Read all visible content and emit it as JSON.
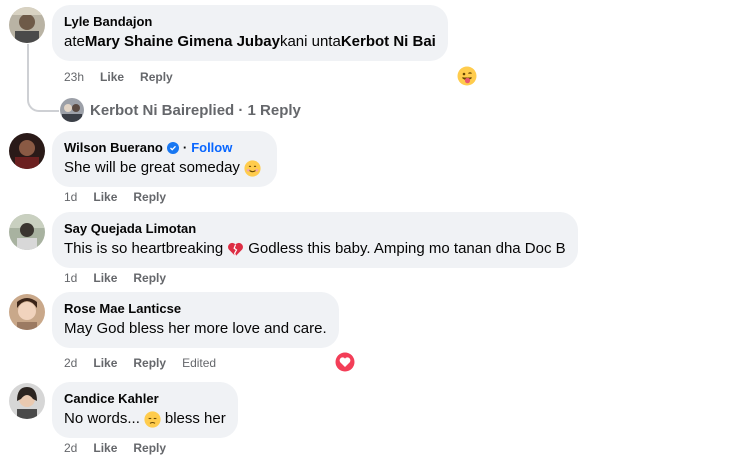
{
  "comments": [
    {
      "author": "Lyle Bandajon",
      "text_parts": [
        "ate ",
        "Mary Shaine Gimena Jubay",
        " kani unta ",
        "Kerbot Ni Bai"
      ],
      "time": "23h",
      "like_label": "Like",
      "reply_label": "Reply",
      "reaction": "tongue-wink-emoji",
      "replies": {
        "replier": "Kerbot Ni Bai",
        "text": " replied · 1 Reply"
      }
    },
    {
      "author": "Wilson Buerano",
      "verified": true,
      "follow_label": "Follow",
      "text": "She will be great someday",
      "inline_emoji": "smile-emoji",
      "time": "1d",
      "like_label": "Like",
      "reply_label": "Reply"
    },
    {
      "author": "Say Quejada Limotan",
      "text_before": "This is so heartbreaking",
      "inline_emoji": "broken-heart-emoji",
      "text_after": "Godless this baby. Amping mo tanan dha Doc B",
      "time": "1d",
      "like_label": "Like",
      "reply_label": "Reply"
    },
    {
      "author": "Rose Mae Lanticse",
      "text": "May God bless her more love and care.",
      "time": "2d",
      "like_label": "Like",
      "reply_label": "Reply",
      "edited_label": "Edited",
      "reaction": "love-reaction"
    },
    {
      "author": "Candice Kahler",
      "text_before": "No words...",
      "inline_emoji": "sad-emoji",
      "text_after": "bless her",
      "time": "2d",
      "like_label": "Like",
      "reply_label": "Reply"
    }
  ],
  "colors": {
    "bubble": "#f0f2f5",
    "meta_text": "#65676b",
    "link_blue": "#0866ff",
    "love_red": "#f33e58"
  }
}
